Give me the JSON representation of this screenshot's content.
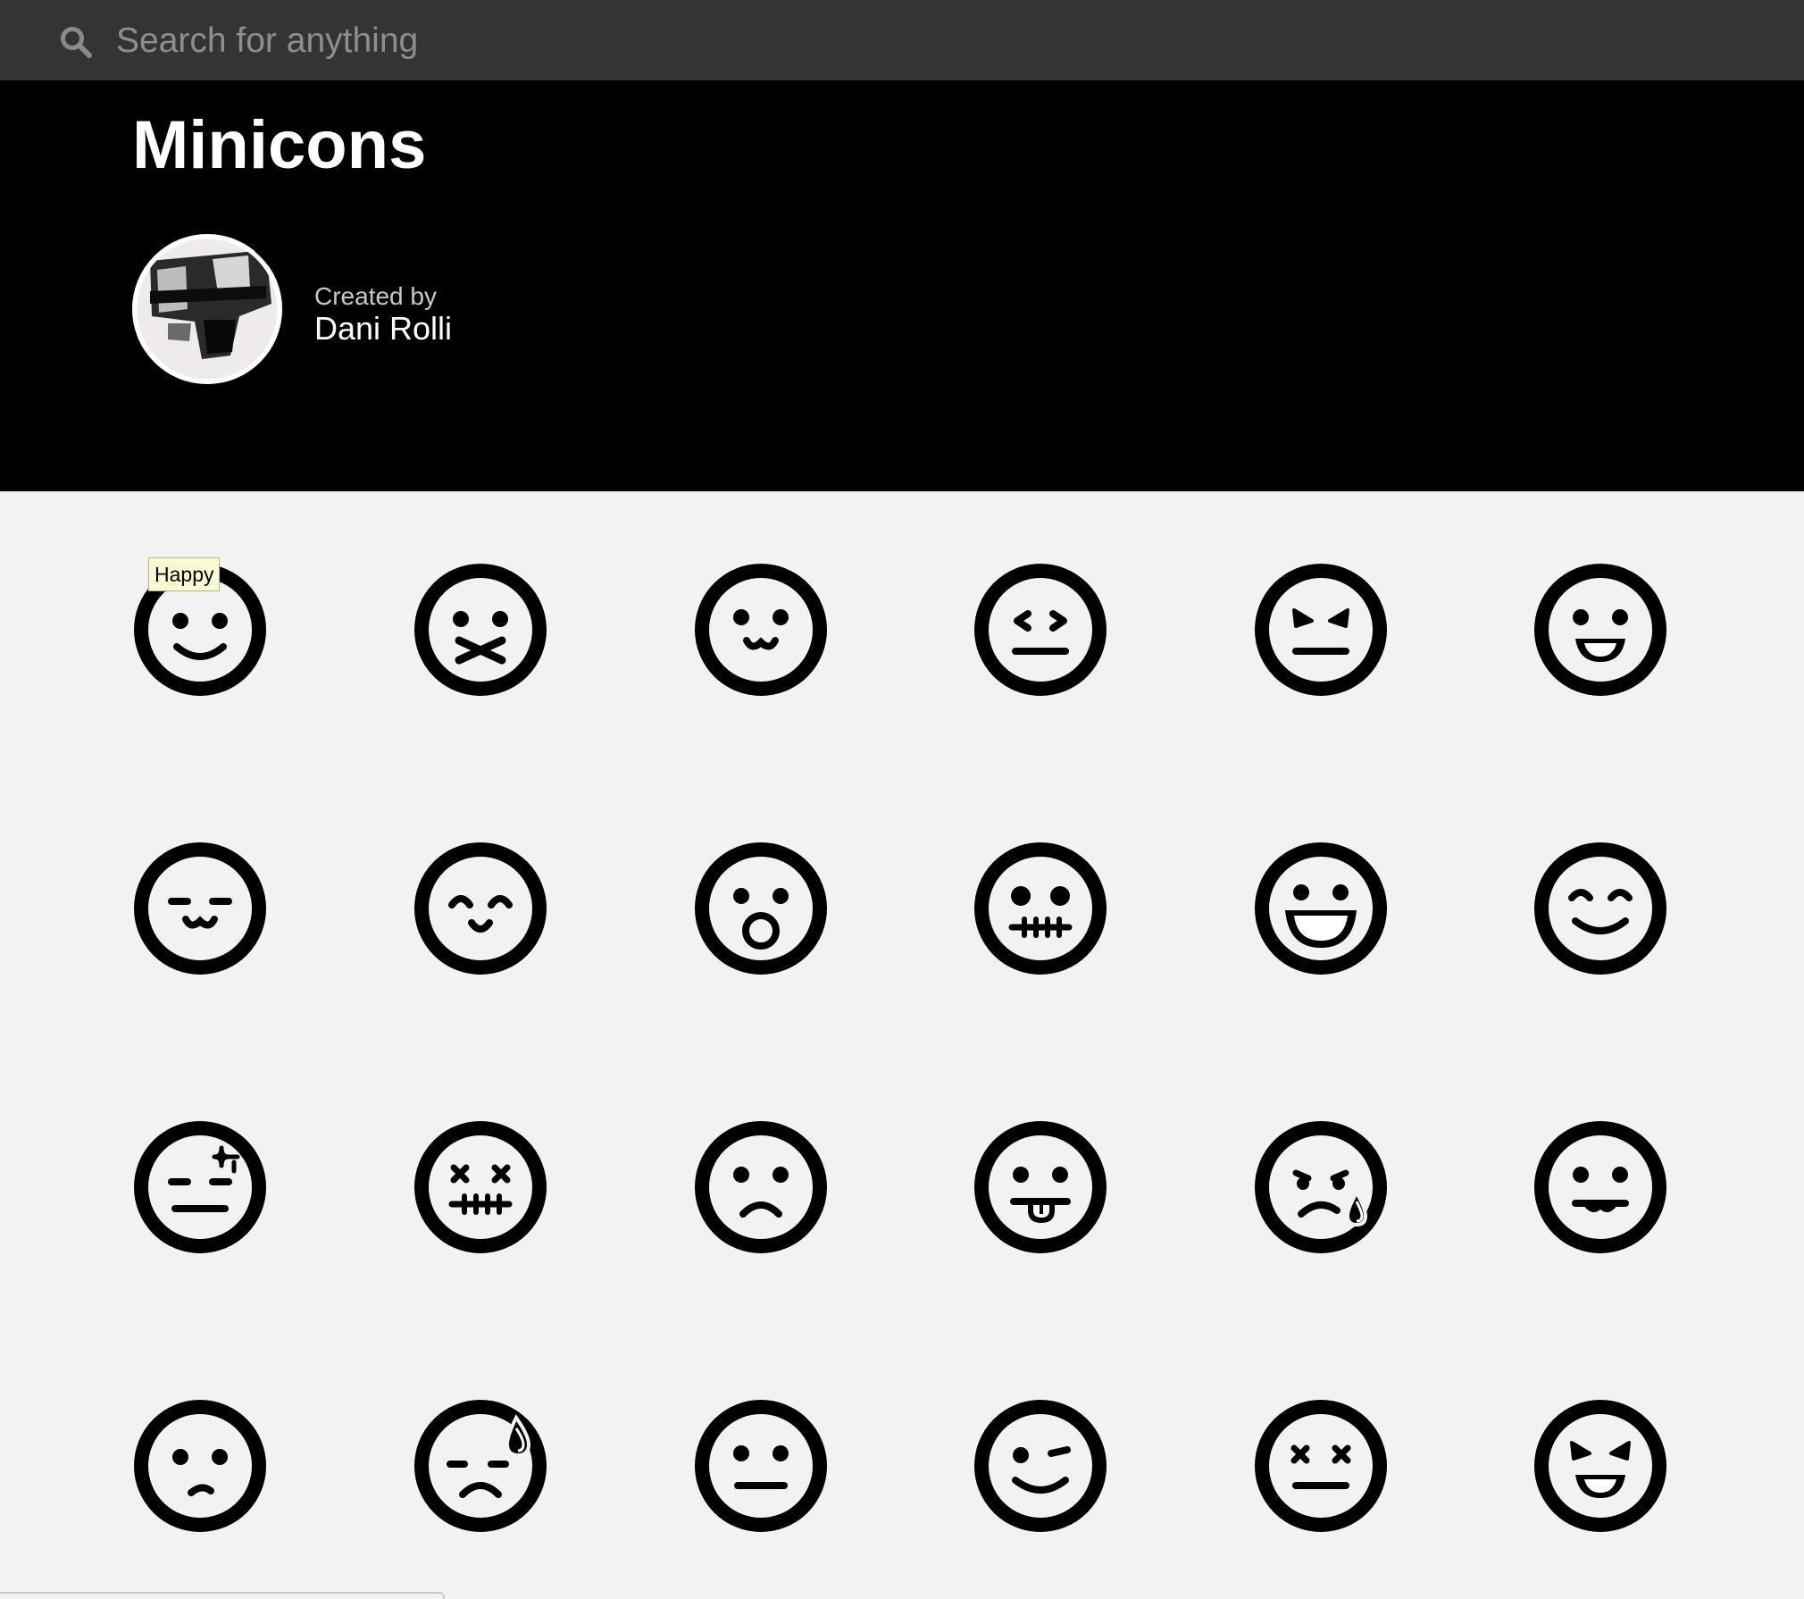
{
  "search": {
    "placeholder": "Search for anything",
    "value": ""
  },
  "page": {
    "title": "Minicons",
    "creator_label": "Created by",
    "creator_name": "Dani Rolli"
  },
  "tooltip": {
    "text": "Happy"
  },
  "colors": {
    "topbar": "#343434",
    "hero": "#000000",
    "canvas": "#f2f2f2",
    "icon": "#000000"
  },
  "icons": [
    "happy-face-icon",
    "mouth-taped-face-icon",
    "cat-mouth-face-icon",
    "annoyed-face-icon",
    "angry-face-icon",
    "grinning-face-icon",
    "sleepy-cat-face-icon",
    "content-face-icon",
    "surprised-face-icon",
    "zipped-mouth-face-icon",
    "big-grin-face-icon",
    "smiling-closed-eyes-face-icon",
    "frustrated-face-icon",
    "dead-face-icon",
    "sad-face-icon",
    "tongue-out-face-icon",
    "crying-face-icon",
    "mustache-face-icon",
    "confused-face-icon",
    "sweating-sad-face-icon",
    "neutral-face-icon",
    "winking-face-icon",
    "dizzy-face-icon",
    "devilish-grin-face-icon"
  ]
}
